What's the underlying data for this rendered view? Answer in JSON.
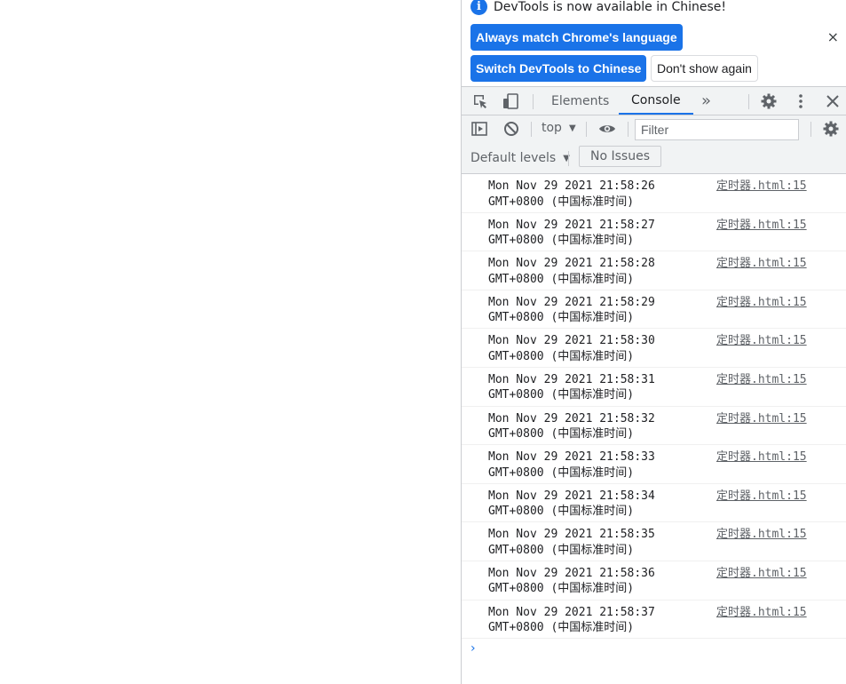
{
  "infobar": {
    "message": "DevTools is now available in Chinese!",
    "buttons": {
      "always_match": "Always match Chrome's language",
      "switch_chinese": "Switch DevTools to Chinese",
      "dont_show": "Don't show again"
    },
    "close": "×"
  },
  "tabs": {
    "elements": "Elements",
    "console": "Console",
    "more": "»"
  },
  "console_toolbar": {
    "context": "top",
    "filter_placeholder": "Filter",
    "default_levels": "Default levels",
    "no_issues": "No Issues"
  },
  "messages": [
    {
      "line1": "Mon Nov 29 2021 21:58:26",
      "line2": "GMT+0800 (中国标准时间)",
      "source": "定时器.html:15"
    },
    {
      "line1": "Mon Nov 29 2021 21:58:27",
      "line2": "GMT+0800 (中国标准时间)",
      "source": "定时器.html:15"
    },
    {
      "line1": "Mon Nov 29 2021 21:58:28",
      "line2": "GMT+0800 (中国标准时间)",
      "source": "定时器.html:15"
    },
    {
      "line1": "Mon Nov 29 2021 21:58:29",
      "line2": "GMT+0800 (中国标准时间)",
      "source": "定时器.html:15"
    },
    {
      "line1": "Mon Nov 29 2021 21:58:30",
      "line2": "GMT+0800 (中国标准时间)",
      "source": "定时器.html:15"
    },
    {
      "line1": "Mon Nov 29 2021 21:58:31",
      "line2": "GMT+0800 (中国标准时间)",
      "source": "定时器.html:15"
    },
    {
      "line1": "Mon Nov 29 2021 21:58:32",
      "line2": "GMT+0800 (中国标准时间)",
      "source": "定时器.html:15"
    },
    {
      "line1": "Mon Nov 29 2021 21:58:33",
      "line2": "GMT+0800 (中国标准时间)",
      "source": "定时器.html:15"
    },
    {
      "line1": "Mon Nov 29 2021 21:58:34",
      "line2": "GMT+0800 (中国标准时间)",
      "source": "定时器.html:15"
    },
    {
      "line1": "Mon Nov 29 2021 21:58:35",
      "line2": "GMT+0800 (中国标准时间)",
      "source": "定时器.html:15"
    },
    {
      "line1": "Mon Nov 29 2021 21:58:36",
      "line2": "GMT+0800 (中国标准时间)",
      "source": "定时器.html:15"
    },
    {
      "line1": "Mon Nov 29 2021 21:58:37",
      "line2": "GMT+0800 (中国标准时间)",
      "source": "定时器.html:15"
    }
  ],
  "prompt": "›",
  "colors": {
    "accent": "#1a73e8",
    "toolbar_bg": "#f1f3f4",
    "border": "#cbcdd1"
  }
}
